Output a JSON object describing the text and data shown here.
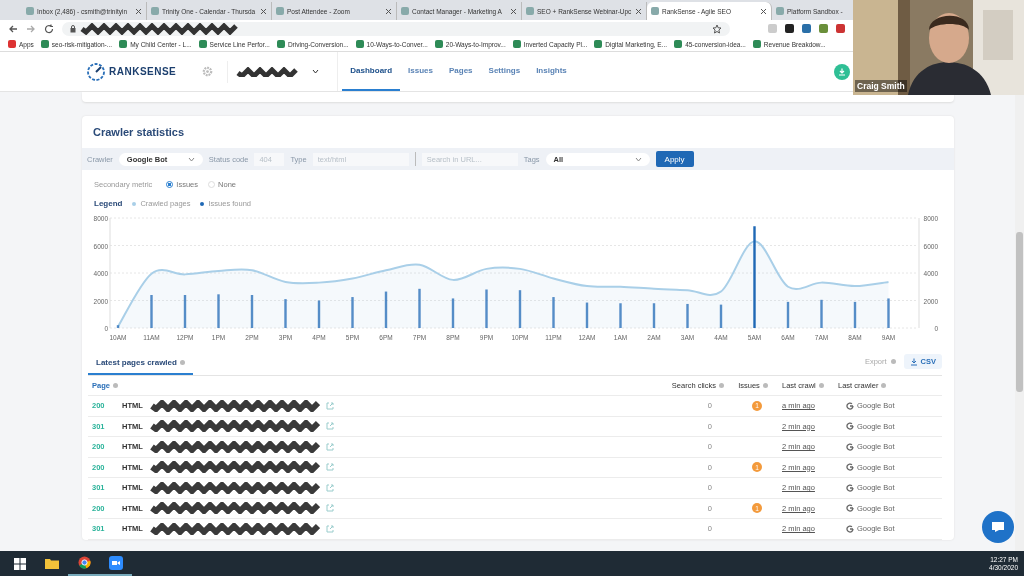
{
  "browser": {
    "tabs": [
      {
        "label": "Inbox (2,486) - csmith@trinityin",
        "selected": false
      },
      {
        "label": "Trinity One - Calendar - Thursda",
        "selected": false
      },
      {
        "label": "Post Attendee - Zoom",
        "selected": false
      },
      {
        "label": "Contact Manager - Marketing A",
        "selected": false
      },
      {
        "label": "SEO + RankSense Webinar-Upc",
        "selected": false
      },
      {
        "label": "RankSense - Agile SEO",
        "selected": true
      },
      {
        "label": "Platform Sandbox -",
        "selected": false
      }
    ],
    "bookmarks": [
      "Apps",
      "seo-risk-mitigation-...",
      "My Child Center - L...",
      "Service Line Perfor...",
      "Driving-Conversion...",
      "10-Ways-to-Conver...",
      "20-Ways-to-Improv...",
      "Inverted Capacity Pl...",
      "Digital Marketing, E...",
      "45-conversion-idea...",
      "Revenue Breakdow..."
    ]
  },
  "app": {
    "logo": "RANKSENSE",
    "nav": [
      {
        "label": "Dashboard",
        "selected": true
      },
      {
        "label": "Issues",
        "selected": false
      },
      {
        "label": "Pages",
        "selected": false
      },
      {
        "label": "Settings",
        "selected": false
      },
      {
        "label": "Insights",
        "selected": false
      }
    ]
  },
  "webcam": {
    "name": "Craig Smith"
  },
  "card": {
    "title": "Crawler statistics",
    "filters": {
      "crawler_label": "Crawler",
      "crawler": "Google Bot",
      "status_label": "Status code",
      "status_placeholder": "404",
      "type_label": "Type",
      "type_placeholder": "text/html",
      "search_placeholder": "Search in URL...",
      "tags_label": "Tags",
      "tags": "All",
      "apply": "Apply"
    },
    "secondary_metric": {
      "label": "Secondary metric",
      "options": [
        {
          "label": "Issues",
          "selected": true
        },
        {
          "label": "None",
          "selected": false
        }
      ]
    },
    "legend_label": "Legend",
    "chart_data": {
      "type": "bar",
      "categories": [
        "10AM",
        "11AM",
        "12PM",
        "1PM",
        "2PM",
        "3PM",
        "4PM",
        "5PM",
        "6PM",
        "7PM",
        "8PM",
        "9PM",
        "10PM",
        "11PM",
        "12AM",
        "1AM",
        "2AM",
        "3AM",
        "4AM",
        "5AM",
        "6AM",
        "7AM",
        "8AM",
        "9AM"
      ],
      "ylim": [
        0,
        8000
      ],
      "yticks": [
        0,
        2000,
        4000,
        6000,
        8000
      ],
      "y2lim": [
        0,
        8000
      ],
      "y2ticks": [
        0,
        2000,
        4000,
        6000,
        8000
      ],
      "grid": true,
      "series": [
        {
          "name": "Crawled pages",
          "type": "area",
          "color": "#a9cfe8",
          "values": [
            100,
            3950,
            3900,
            4150,
            4200,
            3350,
            3300,
            3600,
            4200,
            4600,
            3500,
            4300,
            4300,
            3600,
            3050,
            3000,
            2850,
            2750,
            2650,
            6300,
            3000,
            3300,
            3050,
            3350
          ]
        },
        {
          "name": "Issues found",
          "color": "#1f68b5",
          "values": [
            200,
            2400,
            2400,
            2450,
            2400,
            2100,
            2000,
            2250,
            2650,
            2850,
            2150,
            2800,
            2750,
            2250,
            1850,
            1800,
            1800,
            1750,
            1700,
            7400,
            1900,
            2050,
            1900,
            2150
          ]
        }
      ]
    },
    "table_tab": "Latest pages crawled",
    "export": "Export",
    "csv": "CSV",
    "columns": [
      "Page",
      "Search clicks",
      "Issues",
      "Last crawl",
      "Last crawler"
    ],
    "rows": [
      {
        "status": "200",
        "type": "HTML",
        "clicks": "0",
        "issues": "1",
        "last_crawl": "a min ago",
        "crawler": "Google Bot"
      },
      {
        "status": "301",
        "type": "HTML",
        "clicks": "0",
        "last_crawl": "2 min ago",
        "crawler": "Google Bot"
      },
      {
        "status": "200",
        "type": "HTML",
        "clicks": "0",
        "last_crawl": "2 min ago",
        "crawler": "Google Bot"
      },
      {
        "status": "200",
        "type": "HTML",
        "clicks": "0",
        "issues": "1",
        "last_crawl": "2 min ago",
        "crawler": "Google Bot"
      },
      {
        "status": "301",
        "type": "HTML",
        "clicks": "0",
        "last_crawl": "2 min ago",
        "crawler": "Google Bot"
      },
      {
        "status": "200",
        "type": "HTML",
        "clicks": "0",
        "issues": "1",
        "last_crawl": "2 min ago",
        "crawler": "Google Bot"
      },
      {
        "status": "301",
        "type": "HTML",
        "clicks": "0",
        "last_crawl": "2 min ago",
        "crawler": "Google Bot"
      }
    ]
  },
  "taskbar": {
    "time": "12:27 PM",
    "date": "4/30/2020"
  }
}
